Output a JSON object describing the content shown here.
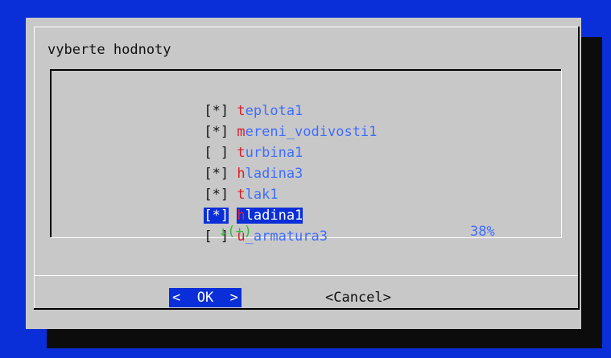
{
  "dialog": {
    "title": "vyberte hodnoty",
    "items": [
      {
        "check": "[*]",
        "hot": "t",
        "rest": "eplota1",
        "selected": false
      },
      {
        "check": "[*]",
        "hot": "m",
        "rest": "ereni_vodivosti1",
        "selected": false
      },
      {
        "check": "[ ]",
        "hot": "t",
        "rest": "urbina1",
        "selected": false
      },
      {
        "check": "[*]",
        "hot": "h",
        "rest": "ladina3",
        "selected": false
      },
      {
        "check": "[*]",
        "hot": "t",
        "rest": "lak1",
        "selected": false
      },
      {
        "check": "[*]",
        "hot": "h",
        "rest": "ladina1",
        "selected": true
      },
      {
        "check": "[ ]",
        "hot": "u",
        "rest": "_armatura3",
        "selected": false
      }
    ],
    "more_indicator": "↓(+)",
    "scroll_percent": "38%",
    "ok_label": "<  OK  >",
    "cancel_label": "<Cancel>"
  },
  "colors": {
    "background": "#0a2fd8",
    "dialog": "#c8c8c8",
    "hotkey": "#d4202b",
    "item_text": "#3f6dff",
    "indicator": "#2fbf2f"
  }
}
